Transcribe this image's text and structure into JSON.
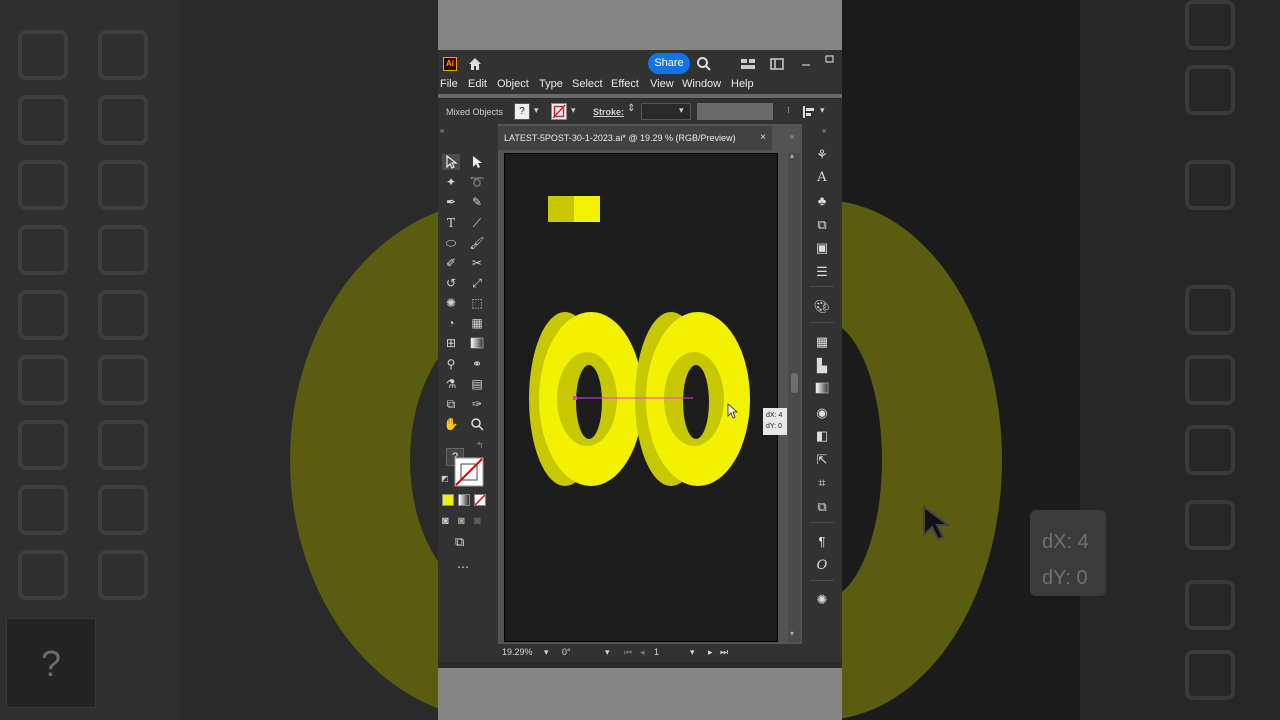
{
  "app": {
    "logo": "Ai",
    "share_label": "Share"
  },
  "menu": {
    "items": [
      "File",
      "Edit",
      "Object",
      "Type",
      "Select",
      "Effect",
      "View",
      "Window",
      "Help"
    ]
  },
  "control_bar": {
    "selection": "Mixed Objects",
    "stroke_label": "Stroke:"
  },
  "document": {
    "tab_title": "LATEST-5POST-30-1-2023.ai* @ 19.29 % (RGB/Preview)",
    "close_glyph": "×"
  },
  "status": {
    "zoom": "19.29%",
    "rotation": "0°",
    "artboard_num": "1"
  },
  "tooltip": {
    "dx": "dX: 4",
    "dy": "dY: 0"
  },
  "backdrop_tooltip": {
    "dx": "dX: 4",
    "dy": "dY: 0"
  },
  "colors": {
    "accent": "#1473e6",
    "yellow_light": "#f2f200",
    "yellow_dark": "#c8c800",
    "guide": "#e040e0"
  },
  "help_glyph": "?"
}
